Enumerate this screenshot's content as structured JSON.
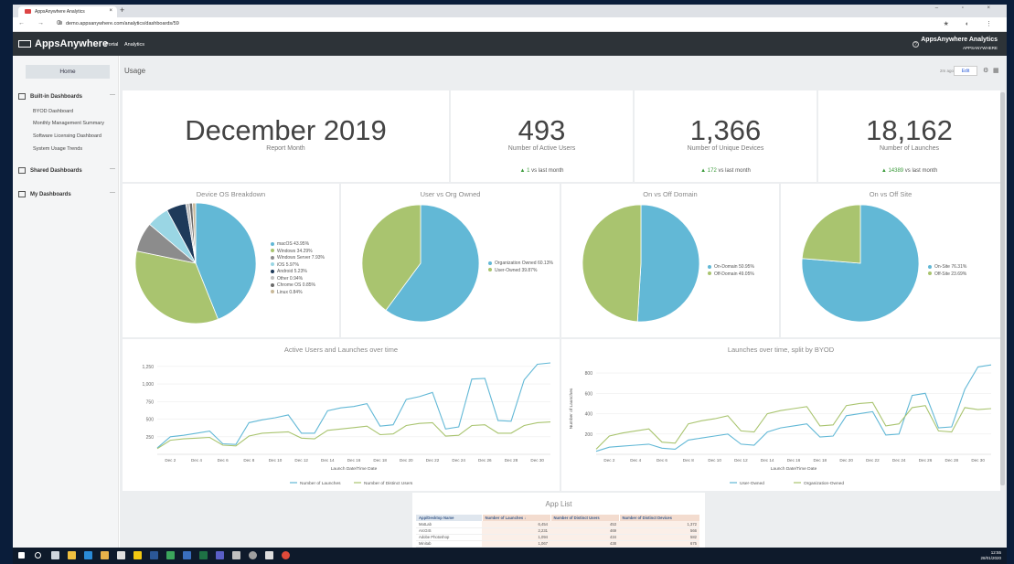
{
  "browser": {
    "tab_title": "AppsAnywhere Analytics",
    "tab_close": "×",
    "new_tab": "+",
    "url": "demo.appsanywhere.com/analytics/dashboards/59",
    "nav": "← → C",
    "window_controls": "– ▫ ×",
    "addr_icons": "★ ◐ ⋮"
  },
  "header": {
    "logo": "AppsAnywhere",
    "links": [
      "Portal",
      "Analytics"
    ],
    "help": "?",
    "org_name": "AppsAnywhere Analytics",
    "org_sub": "APPSANYWHERE"
  },
  "sidebar": {
    "home": "Home",
    "sections": [
      {
        "label": "Built-in Dashboards",
        "dash": "—",
        "items": [
          "BYOD Dashboard",
          "Monthly Management Summary",
          "Software Licensing Dashboard",
          "System Usage Trends"
        ]
      },
      {
        "label": "Shared Dashboards",
        "dash": "—",
        "items": []
      },
      {
        "label": "My Dashboards",
        "dash": "—",
        "items": []
      }
    ]
  },
  "toolbar": {
    "title": "Usage",
    "ago": "2m ago",
    "edit": "Edit",
    "gear": "⚙",
    "grid": "▦"
  },
  "kpis": [
    {
      "value": "December 2019",
      "label": "Report Month",
      "delta": "",
      "delta_text": ""
    },
    {
      "value": "493",
      "label": "Number of Active Users",
      "delta": "▲ 1",
      "delta_text": " vs last month"
    },
    {
      "value": "1,366",
      "label": "Number of Unique Devices",
      "delta": "▲ 172",
      "delta_text": " vs last month"
    },
    {
      "value": "18,162",
      "label": "Number of Launches",
      "delta": "▲ 14389",
      "delta_text": " vs last month"
    }
  ],
  "colors": {
    "blue": "#62b8d6",
    "green": "#a9c46f",
    "grey": "#8c8c8c",
    "lightblue": "#9ad6e4",
    "navy": "#1e3a5a",
    "lightgrey": "#c0c0c0",
    "darkgrey": "#6a6a6a",
    "tan": "#c9b99a"
  },
  "chart_data": [
    {
      "type": "pie",
      "title": "Device OS Breakdown",
      "slices": [
        {
          "label": "macOS 43.95%",
          "value": 43.95,
          "color": "#62b8d6"
        },
        {
          "label": "Windows 34.29%",
          "value": 34.29,
          "color": "#a9c46f"
        },
        {
          "label": "Windows Server 7.93%",
          "value": 7.93,
          "color": "#8c8c8c"
        },
        {
          "label": "iOS 5.97%",
          "value": 5.97,
          "color": "#9ad6e4"
        },
        {
          "label": "Android 5.23%",
          "value": 5.23,
          "color": "#1e3a5a"
        },
        {
          "label": "Other 0.94%",
          "value": 0.94,
          "color": "#c0c0c0"
        },
        {
          "label": "Chrome OS 0.85%",
          "value": 0.85,
          "color": "#6a6a6a"
        },
        {
          "label": "Linux 0.84%",
          "value": 0.84,
          "color": "#c9b99a"
        }
      ]
    },
    {
      "type": "pie",
      "title": "User vs Org Owned",
      "slices": [
        {
          "label": "Organization Owned 60.13%",
          "value": 60.13,
          "color": "#62b8d6"
        },
        {
          "label": "User-Owned 39.87%",
          "value": 39.87,
          "color": "#a9c46f"
        }
      ]
    },
    {
      "type": "pie",
      "title": "On vs Off Domain",
      "slices": [
        {
          "label": "On-Domain 50.95%",
          "value": 50.95,
          "color": "#62b8d6"
        },
        {
          "label": "Off-Domain 49.05%",
          "value": 49.05,
          "color": "#a9c46f"
        }
      ]
    },
    {
      "type": "pie",
      "title": "On vs Off Site",
      "slices": [
        {
          "label": "On-Site 76.31%",
          "value": 76.31,
          "color": "#62b8d6"
        },
        {
          "label": "Off-Site 23.69%",
          "value": 23.69,
          "color": "#a9c46f"
        }
      ]
    },
    {
      "type": "line",
      "title": "Active Users and Launches over time",
      "xlabel": "Launch Date/Time Date",
      "ylabel": "",
      "ylim": [
        0,
        1300
      ],
      "yticks": [
        "250",
        "500",
        "750",
        "1,000",
        "1,250"
      ],
      "ytick_values": [
        250,
        500,
        750,
        1000,
        1250
      ],
      "xticks": [
        "Dec 2",
        "Dec 4",
        "Dec 6",
        "Dec 8",
        "Dec 10",
        "Dec 12",
        "Dec 14",
        "Dec 16",
        "Dec 18",
        "Dec 20",
        "Dec 22",
        "Dec 24",
        "Dec 26",
        "Dec 28",
        "Dec 30"
      ],
      "x": [
        1,
        2,
        3,
        4,
        5,
        6,
        7,
        8,
        9,
        10,
        11,
        12,
        13,
        14,
        15,
        16,
        17,
        18,
        19,
        20,
        21,
        22,
        23,
        24,
        25,
        26,
        27,
        28,
        29,
        30,
        31
      ],
      "series": [
        {
          "name": "Number of Launches",
          "color": "#62b8d6",
          "values": [
            90,
            250,
            270,
            300,
            330,
            150,
            140,
            450,
            490,
            520,
            560,
            300,
            300,
            620,
            660,
            680,
            720,
            400,
            420,
            780,
            820,
            880,
            360,
            390,
            1070,
            1080,
            480,
            470,
            1060,
            1280,
            1300
          ]
        },
        {
          "name": "Number of Distinct Users",
          "color": "#a9c46f",
          "values": [
            80,
            200,
            220,
            230,
            240,
            130,
            120,
            260,
            300,
            310,
            320,
            230,
            220,
            340,
            360,
            380,
            400,
            280,
            290,
            410,
            440,
            450,
            260,
            270,
            410,
            420,
            300,
            300,
            410,
            450,
            460
          ]
        }
      ]
    },
    {
      "type": "line",
      "title": "Launches over time, split by BYOD",
      "xlabel": "Launch Date/Time Date",
      "ylabel": "Number of Launches",
      "ylim": [
        0,
        900
      ],
      "yticks": [
        "200",
        "400",
        "600",
        "800"
      ],
      "ytick_values": [
        200,
        400,
        600,
        800
      ],
      "xticks": [
        "Dec 2",
        "Dec 4",
        "Dec 6",
        "Dec 8",
        "Dec 10",
        "Dec 12",
        "Dec 14",
        "Dec 16",
        "Dec 18",
        "Dec 20",
        "Dec 22",
        "Dec 24",
        "Dec 26",
        "Dec 28",
        "Dec 30"
      ],
      "x": [
        1,
        2,
        3,
        4,
        5,
        6,
        7,
        8,
        9,
        10,
        11,
        12,
        13,
        14,
        15,
        16,
        17,
        18,
        19,
        20,
        21,
        22,
        23,
        24,
        25,
        26,
        27,
        28,
        29,
        30,
        31
      ],
      "series": [
        {
          "name": "User-Owned",
          "color": "#62b8d6",
          "values": [
            30,
            70,
            80,
            90,
            100,
            60,
            50,
            140,
            160,
            180,
            200,
            100,
            90,
            220,
            260,
            280,
            300,
            170,
            180,
            380,
            400,
            420,
            190,
            200,
            580,
            600,
            260,
            270,
            640,
            860,
            880
          ]
        },
        {
          "name": "Organization-Owned",
          "color": "#a9c46f",
          "values": [
            50,
            180,
            210,
            230,
            250,
            120,
            110,
            300,
            330,
            350,
            380,
            230,
            220,
            400,
            430,
            450,
            470,
            280,
            290,
            480,
            500,
            510,
            280,
            300,
            460,
            480,
            230,
            220,
            460,
            440,
            450
          ]
        }
      ]
    }
  ],
  "app_list": {
    "title": "App List",
    "columns": [
      "App/Desktop Name",
      "Number of Launches ↓",
      "Number of Distinct Users",
      "Number of Distinct Devices"
    ],
    "rows": [
      [
        "MatLab",
        "6,454",
        "453",
        "1,372"
      ],
      [
        "ArcGIS",
        "2,231",
        "469",
        "566"
      ],
      [
        "Adobe Photoshop",
        "1,094",
        "434",
        "582"
      ],
      [
        "Minitab",
        "1,067",
        "438",
        "675"
      ]
    ]
  },
  "taskbar": {
    "time": "12:55",
    "date": "28/01/2020"
  }
}
